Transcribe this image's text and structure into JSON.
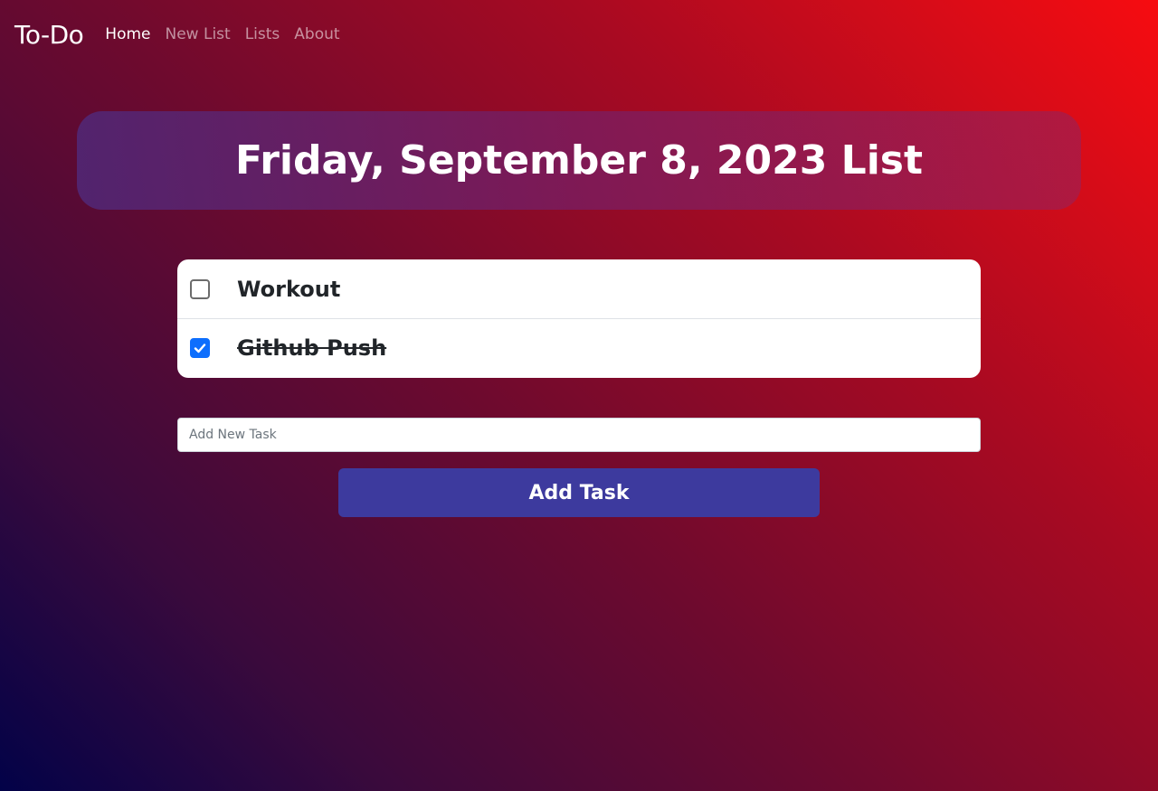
{
  "nav": {
    "brand": "To-Do",
    "links": [
      {
        "label": "Home",
        "active": true
      },
      {
        "label": "New List",
        "active": false
      },
      {
        "label": "Lists",
        "active": false
      },
      {
        "label": "About",
        "active": false
      }
    ]
  },
  "title": "Friday, September 8, 2023 List",
  "tasks": [
    {
      "label": "Workout",
      "checked": false
    },
    {
      "label": "Github Push",
      "checked": true
    }
  ],
  "add_task": {
    "placeholder": "Add New Task",
    "value": "",
    "button_label": "Add Task"
  },
  "colors": {
    "checkbox_checked": "#0d6efd",
    "button": "#3d3a9e",
    "gradient_start": "#020248",
    "gradient_end": "#f70c10"
  }
}
